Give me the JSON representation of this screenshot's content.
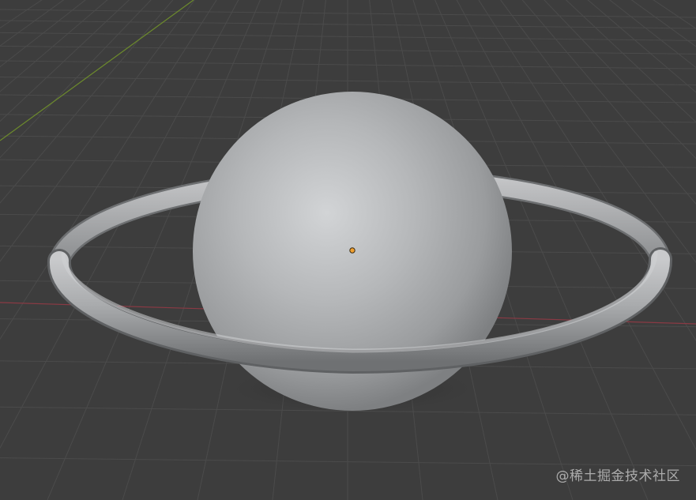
{
  "viewport": {
    "background_color": "#3d3d3d",
    "grid_line_color": "#4a4a4a",
    "x_axis_color": "#8a3a44",
    "y_axis_color": "#6c8a2c",
    "mesh_color": "#9a9a9a",
    "origin_color": "#f0a030"
  },
  "scene": {
    "objects": [
      "sphere",
      "torus-ring"
    ],
    "selected_origin": "origin-dot"
  },
  "watermark": {
    "text": "@稀土掘金技术社区"
  }
}
